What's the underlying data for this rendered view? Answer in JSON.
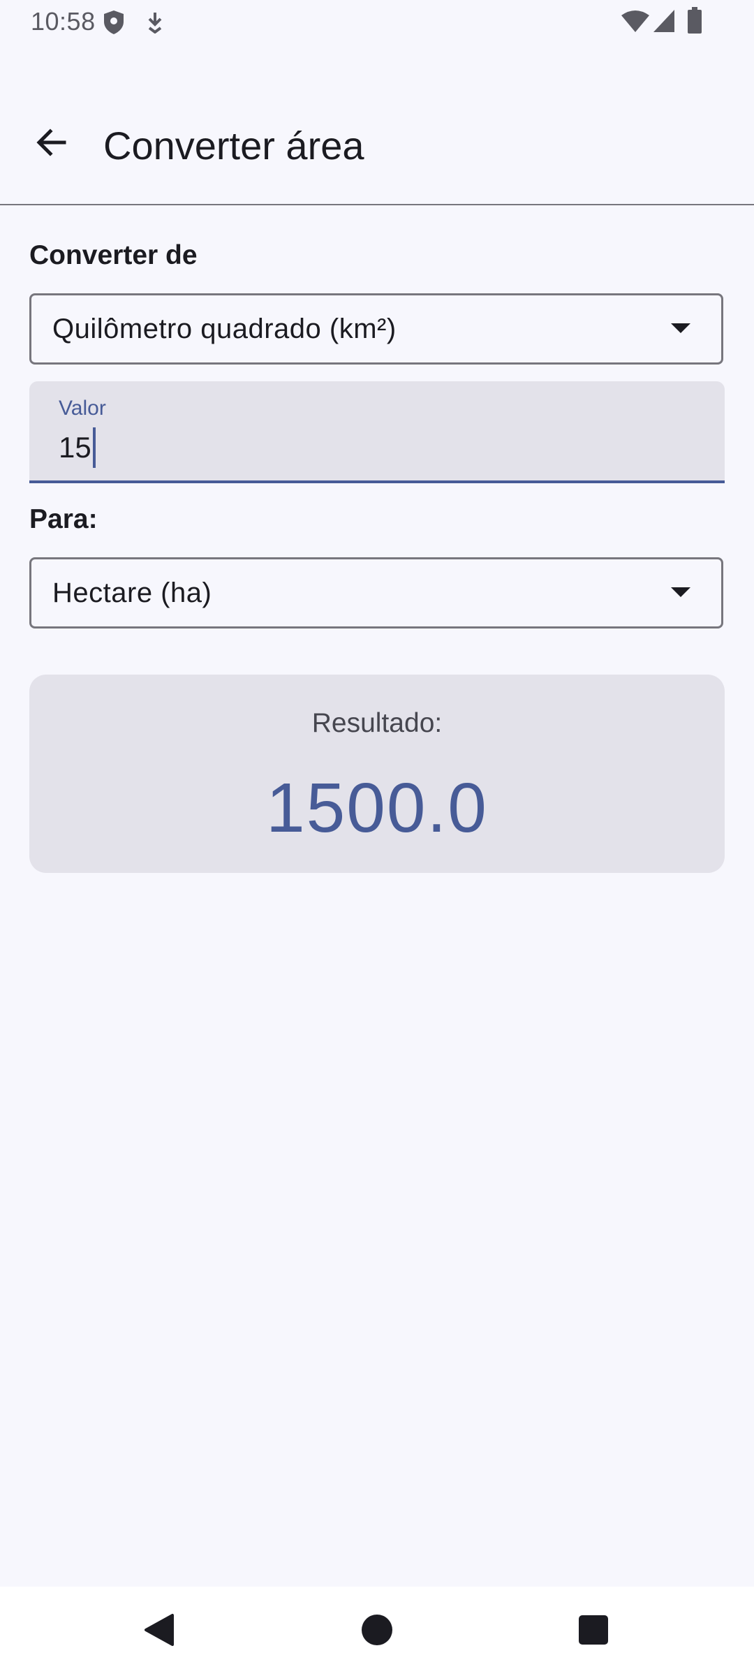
{
  "status_bar": {
    "time": "10:58",
    "icons": [
      "shield-icon",
      "download-icon",
      "wifi-icon",
      "signal-icon",
      "battery-icon"
    ]
  },
  "app_bar": {
    "back_icon": "arrow-back-icon",
    "title": "Converter área"
  },
  "form": {
    "from_label": "Converter de",
    "from_unit": "Quilômetro quadrado (km²)",
    "value_label": "Valor",
    "value": "15",
    "to_label": "Para:",
    "to_unit": "Hectare (ha)"
  },
  "result": {
    "label": "Resultado:",
    "value": "1500.0"
  },
  "nav_bar": {
    "icons": [
      "back-icon",
      "home-icon",
      "recents-icon"
    ]
  },
  "colors": {
    "accent": "#475b97",
    "background": "#f7f7fd",
    "surface_variant": "#e3e2ea",
    "outline": "#77767d"
  }
}
